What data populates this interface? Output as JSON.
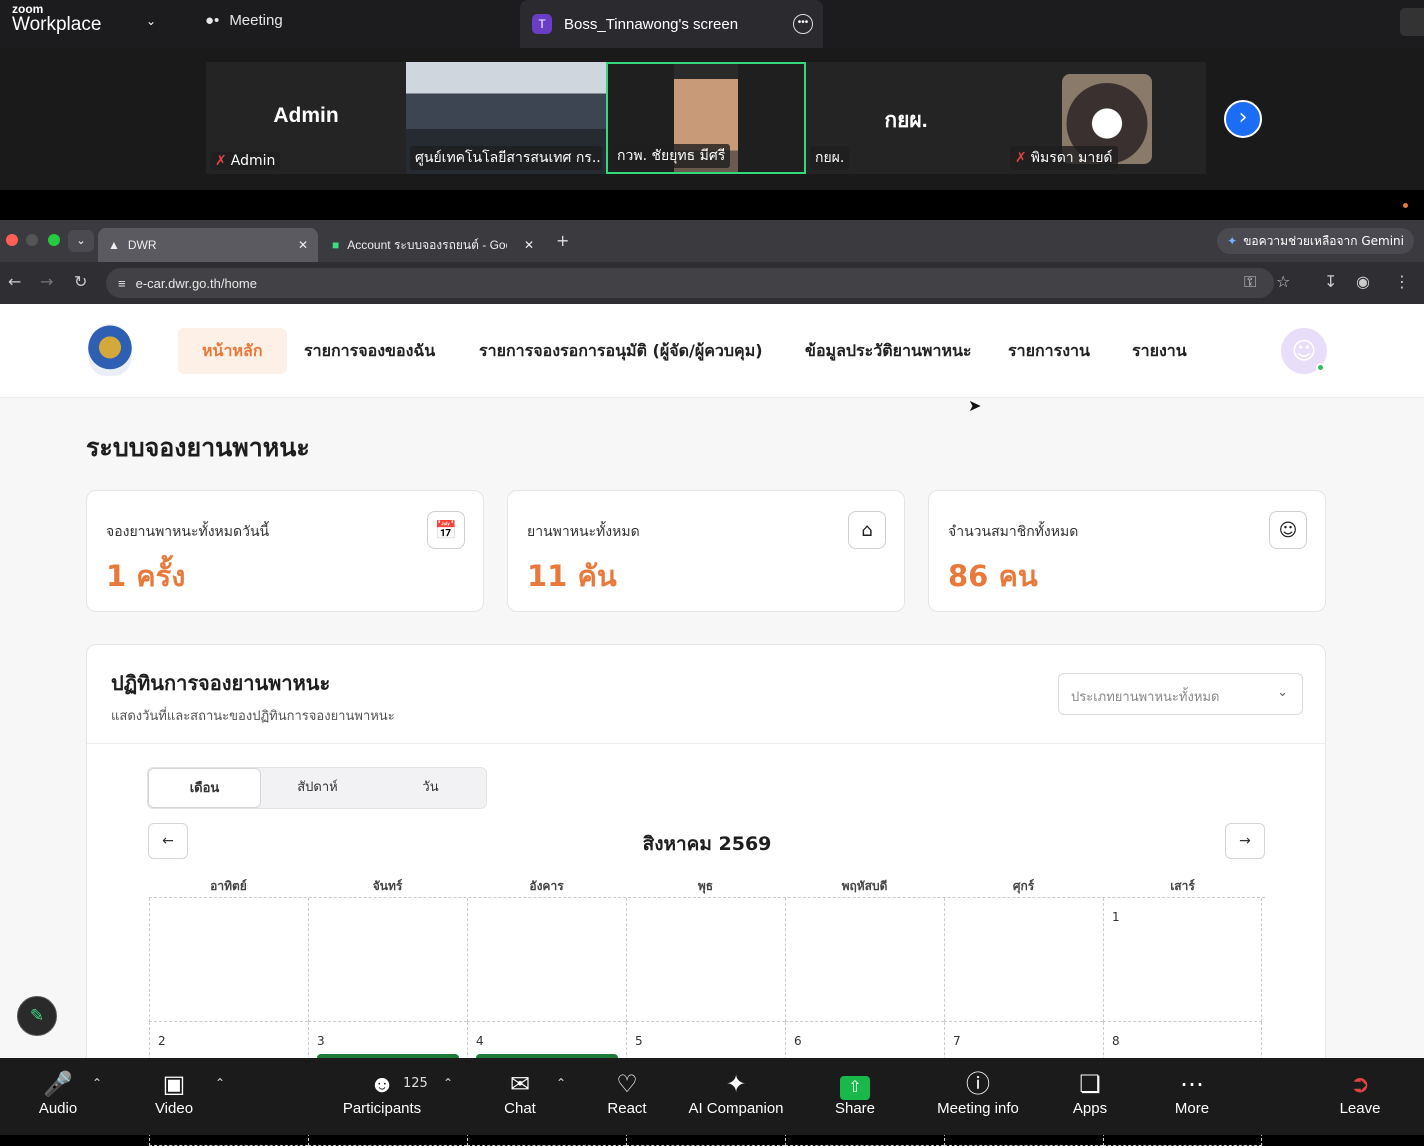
{
  "zoom": {
    "logo_top": "zoom",
    "logo_bottom": "Workplace",
    "meeting_label": "Meeting",
    "share_badge": "T",
    "share_label": "Boss_Tinnawong's screen"
  },
  "gallery": {
    "tiles": [
      {
        "big": "Admin",
        "name": "Admin",
        "muted": true
      },
      {
        "big": "",
        "name": "ศูนย์เทคโนโลยีสารสนเทศ กร...",
        "muted": false
      },
      {
        "big": "",
        "name": "กวพ.  ชัยยุทธ มีศรี",
        "muted": false
      },
      {
        "big": "กยผ.",
        "name": "กยผ.",
        "muted": false
      },
      {
        "big": "",
        "name": "พิมรดา มายด์",
        "muted": true
      }
    ]
  },
  "browser": {
    "tab1": "DWR",
    "tab2": "Account ระบบจองรถยนต์ - Goo",
    "gemini": "ขอความช่วยเหลือจาก Gemini",
    "url": "e-car.dwr.go.th/home"
  },
  "nav": {
    "items": [
      "หน้าหลัก",
      "รายการจองของฉัน",
      "รายการจองรอการอนุมัติ (ผู้จัด/ผู้ควบคุม)",
      "ข้อมูลประวัติยานพาหนะ",
      "รายการงาน",
      "รายงาน"
    ]
  },
  "page": {
    "title": "ระบบจองยานพาหนะ"
  },
  "cards": [
    {
      "label": "จองยานพาหนะทั้งหมดวันนี้",
      "value": "1 ครั้ง",
      "icon": "calendar-check-icon"
    },
    {
      "label": "ยานพาหนะทั้งหมด",
      "value": "11 คัน",
      "icon": "home-icon"
    },
    {
      "label": "จำนวนสมาชิกทั้งหมด",
      "value": "86 คน",
      "icon": "users-icon"
    }
  ],
  "calendar": {
    "title": "ปฏิทินการจองยานพาหนะ",
    "subtitle": "แสดงวันที่และสถานะของปฏิทินการจองยานพาหนะ",
    "filter": "ประเภทยานพาหนะทั้งหมด",
    "views": [
      "เดือน",
      "สัปดาห์",
      "วัน"
    ],
    "month": "สิงหาคม 2569",
    "days": [
      "อาทิตย์",
      "จันทร์",
      "อังคาร",
      "พุธ",
      "พฤหัสบดี",
      "ศุกร์",
      "เสาร์"
    ],
    "week1": [
      "",
      "",
      "",
      "",
      "",
      "",
      "1"
    ],
    "week2": [
      "2",
      "3",
      "4",
      "5",
      "6",
      "7",
      "8"
    ]
  },
  "toolbar": {
    "audio": "Audio",
    "video": "Video",
    "participants": "Participants",
    "participant_count": "125",
    "chat": "Chat",
    "react": "React",
    "ai": "AI Companion",
    "share": "Share",
    "info": "Meeting info",
    "apps": "Apps",
    "more": "More",
    "leave": "Leave"
  }
}
